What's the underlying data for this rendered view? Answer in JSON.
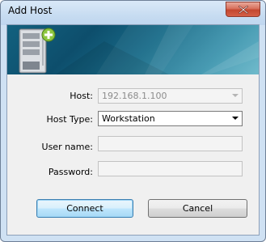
{
  "window": {
    "title": "Add Host",
    "close_label": "close"
  },
  "form": {
    "host": {
      "label": "Host:",
      "value": "192.168.1.100"
    },
    "host_type": {
      "label": "Host Type:",
      "value": "Workstation"
    },
    "user_name": {
      "label": "User name:",
      "value": ""
    },
    "password": {
      "label": "Password:",
      "value": ""
    }
  },
  "buttons": {
    "connect": "Connect",
    "cancel": "Cancel"
  },
  "banner": {
    "icon": "server-add-icon"
  },
  "colors": {
    "banner": "#13617f",
    "titlebar": "#cfe1f3",
    "close_button": "#c4472f",
    "add_badge": "#8dc63f"
  }
}
